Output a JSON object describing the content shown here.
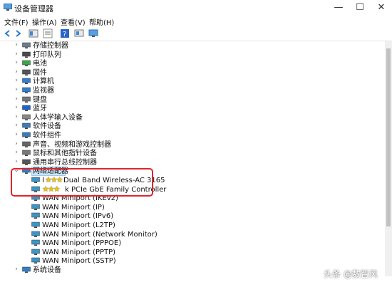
{
  "window": {
    "title": "设备管理器"
  },
  "menubar": {
    "items": [
      "文件(F)",
      "操作(A)",
      "查看(V)",
      "帮助(H)"
    ]
  },
  "tree": [
    {
      "label": "存储控制器",
      "icon": "storage-controller-icon",
      "chev": "›"
    },
    {
      "label": "打印队列",
      "icon": "printer-icon",
      "chev": "›"
    },
    {
      "label": "电池",
      "icon": "battery-icon",
      "chev": "›"
    },
    {
      "label": "固件",
      "icon": "firmware-icon",
      "chev": "›"
    },
    {
      "label": "计算机",
      "icon": "computer-icon",
      "chev": "›"
    },
    {
      "label": "监视器",
      "icon": "monitor-icon",
      "chev": "›"
    },
    {
      "label": "键盘",
      "icon": "keyboard-icon",
      "chev": "›"
    },
    {
      "label": "蓝牙",
      "icon": "bluetooth-icon",
      "chev": "›"
    },
    {
      "label": "人体学输入设备",
      "icon": "hid-icon",
      "chev": "›"
    },
    {
      "label": "软件设备",
      "icon": "software-device-icon",
      "chev": "›"
    },
    {
      "label": "软件组件",
      "icon": "software-component-icon",
      "chev": "›"
    },
    {
      "label": "声音、视频和游戏控制器",
      "icon": "sound-icon",
      "chev": "›"
    },
    {
      "label": "鼠标和其他指针设备",
      "icon": "mouse-icon",
      "chev": "›"
    },
    {
      "label": "通用串行总线控制器",
      "icon": "usb-icon",
      "chev": "›"
    },
    {
      "label": "网络适配器",
      "icon": "network-adapter-icon",
      "chev": "⌄",
      "selected": true
    },
    {
      "label": "Dual Band Wireless-AC 3165",
      "prefix": "I",
      "icon": "network-card-icon",
      "child": true
    },
    {
      "label": "k PCIe GbE Family Controller",
      "icon": "network-card-icon",
      "child": true
    },
    {
      "label": "WAN Miniport (IKEv2)",
      "icon": "network-card-icon",
      "child": true
    },
    {
      "label": "WAN Miniport (IP)",
      "icon": "network-card-icon",
      "child": true
    },
    {
      "label": "WAN Miniport (IPv6)",
      "icon": "network-card-icon",
      "child": true
    },
    {
      "label": "WAN Miniport (L2TP)",
      "icon": "network-card-icon",
      "child": true
    },
    {
      "label": "WAN Miniport (Network Monitor)",
      "icon": "network-card-icon",
      "child": true
    },
    {
      "label": "WAN Miniport (PPPOE)",
      "icon": "network-card-icon",
      "child": true
    },
    {
      "label": "WAN Miniport (PPTP)",
      "icon": "network-card-icon",
      "child": true
    },
    {
      "label": "WAN Miniport (SSTP)",
      "icon": "network-card-icon",
      "child": true
    },
    {
      "label": "系统设备",
      "icon": "system-device-icon",
      "chev": "›"
    }
  ],
  "watermark": "头条 @数智风",
  "colors": {
    "selection": "#cce4f7",
    "highlight_box": "#e0242a",
    "censor_stars": "#f1c40f"
  }
}
